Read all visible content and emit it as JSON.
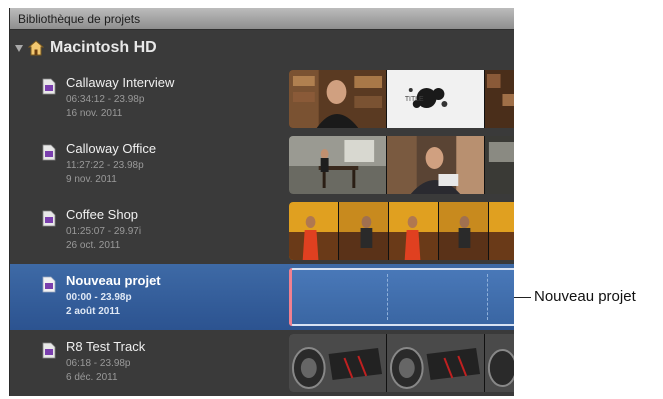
{
  "window": {
    "title": "Bibliothèque de projets"
  },
  "volume": {
    "label": "Macintosh HD",
    "icon": "house-icon"
  },
  "projects": [
    {
      "name": "Callaway Interview",
      "timecode": "06:34:12 - 23.98p",
      "date": "16 nov. 2011",
      "selected": false
    },
    {
      "name": "Calloway Office",
      "timecode": "11:27:22 - 23.98p",
      "date": "9 nov. 2011",
      "selected": false
    },
    {
      "name": "Coffee Shop",
      "timecode": "01:25:07 - 29.97i",
      "date": "26 oct. 2011",
      "selected": false
    },
    {
      "name": "Nouveau projet",
      "timecode": "00:00 - 23.98p",
      "date": "2 août 2011",
      "selected": true
    },
    {
      "name": "R8 Test Track",
      "timecode": "06:18 - 23.98p",
      "date": "6 déc. 2011",
      "selected": false
    }
  ],
  "callout": {
    "label": "Nouveau projet"
  },
  "colors": {
    "selection": "#3e6aa6",
    "panel": "#3a3a3a",
    "titlebar": "#a8a8a8"
  }
}
